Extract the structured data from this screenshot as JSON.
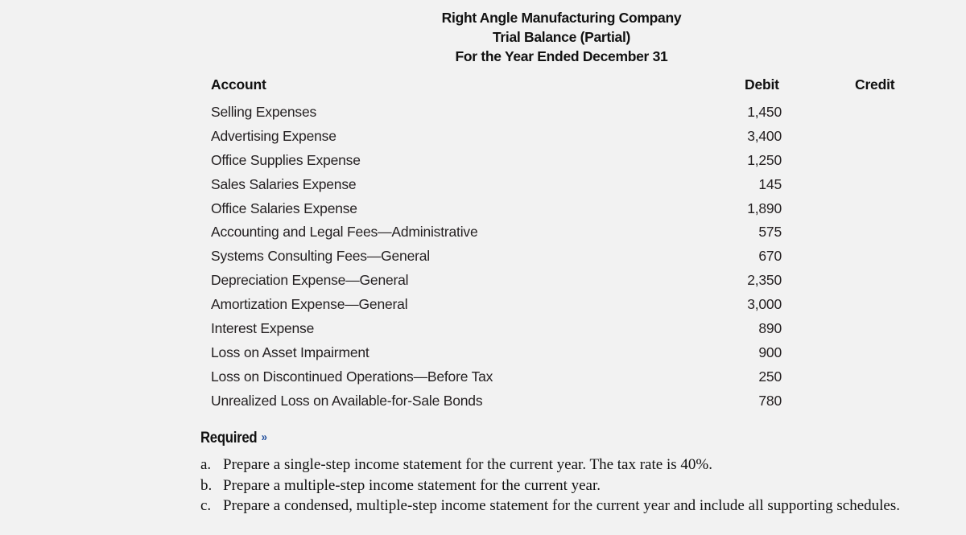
{
  "heading": {
    "company": "Right Angle Manufacturing Company",
    "statement": "Trial Balance (Partial)",
    "period": "For the Year Ended December 31"
  },
  "table": {
    "columns": {
      "account": "Account",
      "debit": "Debit",
      "credit": "Credit"
    },
    "rows": [
      {
        "account": "Selling Expenses",
        "debit": "1,450",
        "credit": ""
      },
      {
        "account": "Advertising Expense",
        "debit": "3,400",
        "credit": ""
      },
      {
        "account": "Office Supplies Expense",
        "debit": "1,250",
        "credit": ""
      },
      {
        "account": "Sales Salaries Expense",
        "debit": "145",
        "credit": ""
      },
      {
        "account": "Office Salaries Expense",
        "debit": "1,890",
        "credit": ""
      },
      {
        "account": "Accounting and Legal Fees—Administrative",
        "debit": "575",
        "credit": ""
      },
      {
        "account": "Systems Consulting Fees—General",
        "debit": "670",
        "credit": ""
      },
      {
        "account": "Depreciation Expense—General",
        "debit": "2,350",
        "credit": ""
      },
      {
        "account": "Amortization Expense—General",
        "debit": "3,000",
        "credit": ""
      },
      {
        "account": "Interest Expense",
        "debit": "890",
        "credit": ""
      },
      {
        "account": "Loss on Asset Impairment",
        "debit": "900",
        "credit": ""
      },
      {
        "account": "Loss on Discontinued Operations—Before Tax",
        "debit": "250",
        "credit": ""
      },
      {
        "account": "Unrealized Loss on Available-for-Sale Bonds",
        "debit": "780",
        "credit": ""
      }
    ]
  },
  "required": {
    "label": "Required",
    "arrow_icon": "»",
    "accent_color": "#1f4e9c",
    "items": [
      {
        "letter": "a.",
        "text": "Prepare a single-step income statement for the current year. The tax rate is 40%."
      },
      {
        "letter": "b.",
        "text": "Prepare a multiple-step income statement for the current year."
      },
      {
        "letter": "c.",
        "text": "Prepare a condensed, multiple-step income statement for the current year and include all supporting schedules."
      }
    ]
  }
}
